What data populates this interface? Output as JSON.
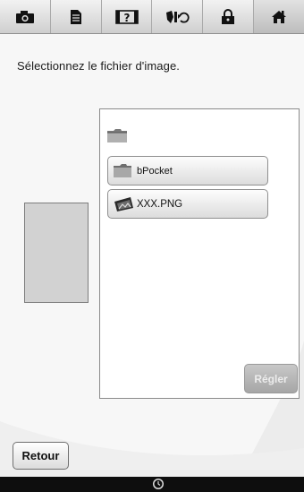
{
  "instruction": "Sélectionnez le fichier d'image.",
  "toolbar": {
    "icons": [
      "camera-icon",
      "document-icon",
      "help-icon",
      "thread-change-icon",
      "lock-icon",
      "home-icon"
    ]
  },
  "file_browser": {
    "items": [
      {
        "label": "bPocket",
        "icon": "folder-icon"
      },
      {
        "label": "XXX.PNG",
        "icon": "image-file-icon"
      }
    ],
    "set_button": "Régler"
  },
  "back_button": "Retour",
  "colors": {
    "toolbar": "#dcdcdc",
    "background": "#f7f7f7",
    "panel": "#ffffff",
    "disabled_button": "#b4b4b4",
    "bottom_bar": "#0e0e0e"
  }
}
